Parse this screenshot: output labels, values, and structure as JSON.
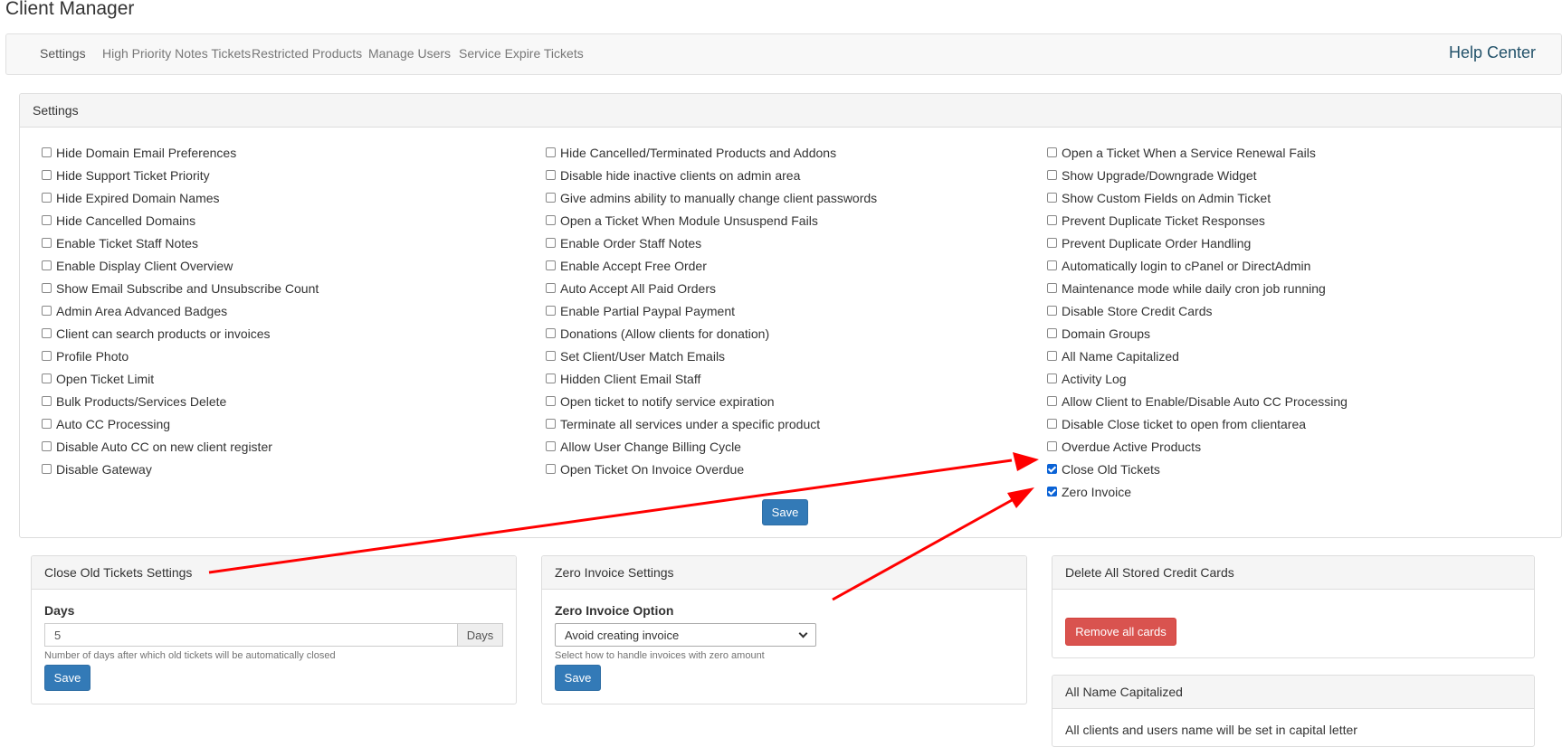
{
  "page": {
    "title": "Client Manager"
  },
  "nav": {
    "items": [
      {
        "label": "Settings"
      },
      {
        "label": "High Priority Notes Tickets"
      },
      {
        "label": "Restricted Products"
      },
      {
        "label": "Manage Users"
      },
      {
        "label": "Service Expire Tickets"
      }
    ],
    "help_center": "Help Center"
  },
  "settings": {
    "heading": "Settings",
    "columns": [
      [
        {
          "label": "Hide Domain Email Preferences",
          "checked": false
        },
        {
          "label": "Hide Support Ticket Priority",
          "checked": false
        },
        {
          "label": "Hide Expired Domain Names",
          "checked": false
        },
        {
          "label": "Hide Cancelled Domains",
          "checked": false
        },
        {
          "label": "Enable Ticket Staff Notes",
          "checked": false
        },
        {
          "label": "Enable Display Client Overview",
          "checked": false
        },
        {
          "label": "Show Email Subscribe and Unsubscribe Count",
          "checked": false
        },
        {
          "label": "Admin Area Advanced Badges",
          "checked": false
        },
        {
          "label": "Client can search products or invoices",
          "checked": false
        },
        {
          "label": "Profile Photo",
          "checked": false
        },
        {
          "label": "Open Ticket Limit",
          "checked": false
        },
        {
          "label": "Bulk Products/Services Delete",
          "checked": false
        },
        {
          "label": "Auto CC Processing",
          "checked": false
        },
        {
          "label": "Disable Auto CC on new client register",
          "checked": false
        },
        {
          "label": "Disable Gateway",
          "checked": false
        }
      ],
      [
        {
          "label": "Hide Cancelled/Terminated Products and Addons",
          "checked": false
        },
        {
          "label": "Disable hide inactive clients on admin area",
          "checked": false
        },
        {
          "label": "Give admins ability to manually change client passwords",
          "checked": false
        },
        {
          "label": "Open a Ticket When Module Unsuspend Fails",
          "checked": false
        },
        {
          "label": "Enable Order Staff Notes",
          "checked": false
        },
        {
          "label": "Enable Accept Free Order",
          "checked": false
        },
        {
          "label": "Auto Accept All Paid Orders",
          "checked": false
        },
        {
          "label": "Enable Partial Paypal Payment",
          "checked": false
        },
        {
          "label": "Donations (Allow clients for donation)",
          "checked": false
        },
        {
          "label": "Set Client/User Match Emails",
          "checked": false
        },
        {
          "label": "Hidden Client Email Staff",
          "checked": false
        },
        {
          "label": "Open ticket to notify service expiration",
          "checked": false
        },
        {
          "label": "Terminate all services under a specific product",
          "checked": false
        },
        {
          "label": "Allow User Change Billing Cycle",
          "checked": false
        },
        {
          "label": "Open Ticket On Invoice Overdue",
          "checked": false
        }
      ],
      [
        {
          "label": "Open a Ticket When a Service Renewal Fails",
          "checked": false
        },
        {
          "label": "Show Upgrade/Downgrade Widget",
          "checked": false
        },
        {
          "label": "Show Custom Fields on Admin Ticket",
          "checked": false
        },
        {
          "label": "Prevent Duplicate Ticket Responses",
          "checked": false
        },
        {
          "label": "Prevent Duplicate Order Handling",
          "checked": false
        },
        {
          "label": "Automatically login to cPanel or DirectAdmin",
          "checked": false
        },
        {
          "label": "Maintenance mode while daily cron job running",
          "checked": false
        },
        {
          "label": "Disable Store Credit Cards",
          "checked": false
        },
        {
          "label": "Domain Groups",
          "checked": false
        },
        {
          "label": "All Name Capitalized",
          "checked": false
        },
        {
          "label": "Activity Log",
          "checked": false
        },
        {
          "label": "Allow Client to Enable/Disable Auto CC Processing",
          "checked": false
        },
        {
          "label": "Disable Close ticket to open from clientarea",
          "checked": false
        },
        {
          "label": "Overdue Active Products",
          "checked": false
        },
        {
          "label": "Close Old Tickets",
          "checked": true
        },
        {
          "label": "Zero Invoice",
          "checked": true
        }
      ]
    ],
    "save_label": "Save"
  },
  "close_old_tickets": {
    "heading": "Close Old Tickets Settings",
    "days_label": "Days",
    "days_value": "5",
    "days_addon": "Days",
    "help": "Number of days after which old tickets will be automatically closed",
    "save_label": "Save"
  },
  "zero_invoice": {
    "heading": "Zero Invoice Settings",
    "option_label": "Zero Invoice Option",
    "selected": "Avoid creating invoice",
    "help": "Select how to handle invoices with zero amount",
    "save_label": "Save"
  },
  "delete_cards": {
    "heading": "Delete All Stored Credit Cards",
    "button_label": "Remove all cards"
  },
  "all_name_capitalized": {
    "heading": "All Name Capitalized",
    "text": "All clients and users name will be set in capital letter"
  },
  "colors": {
    "primary": "#337ab7",
    "danger": "#d9534f",
    "arrow": "#ff0000",
    "checked": "#0b63d6"
  }
}
